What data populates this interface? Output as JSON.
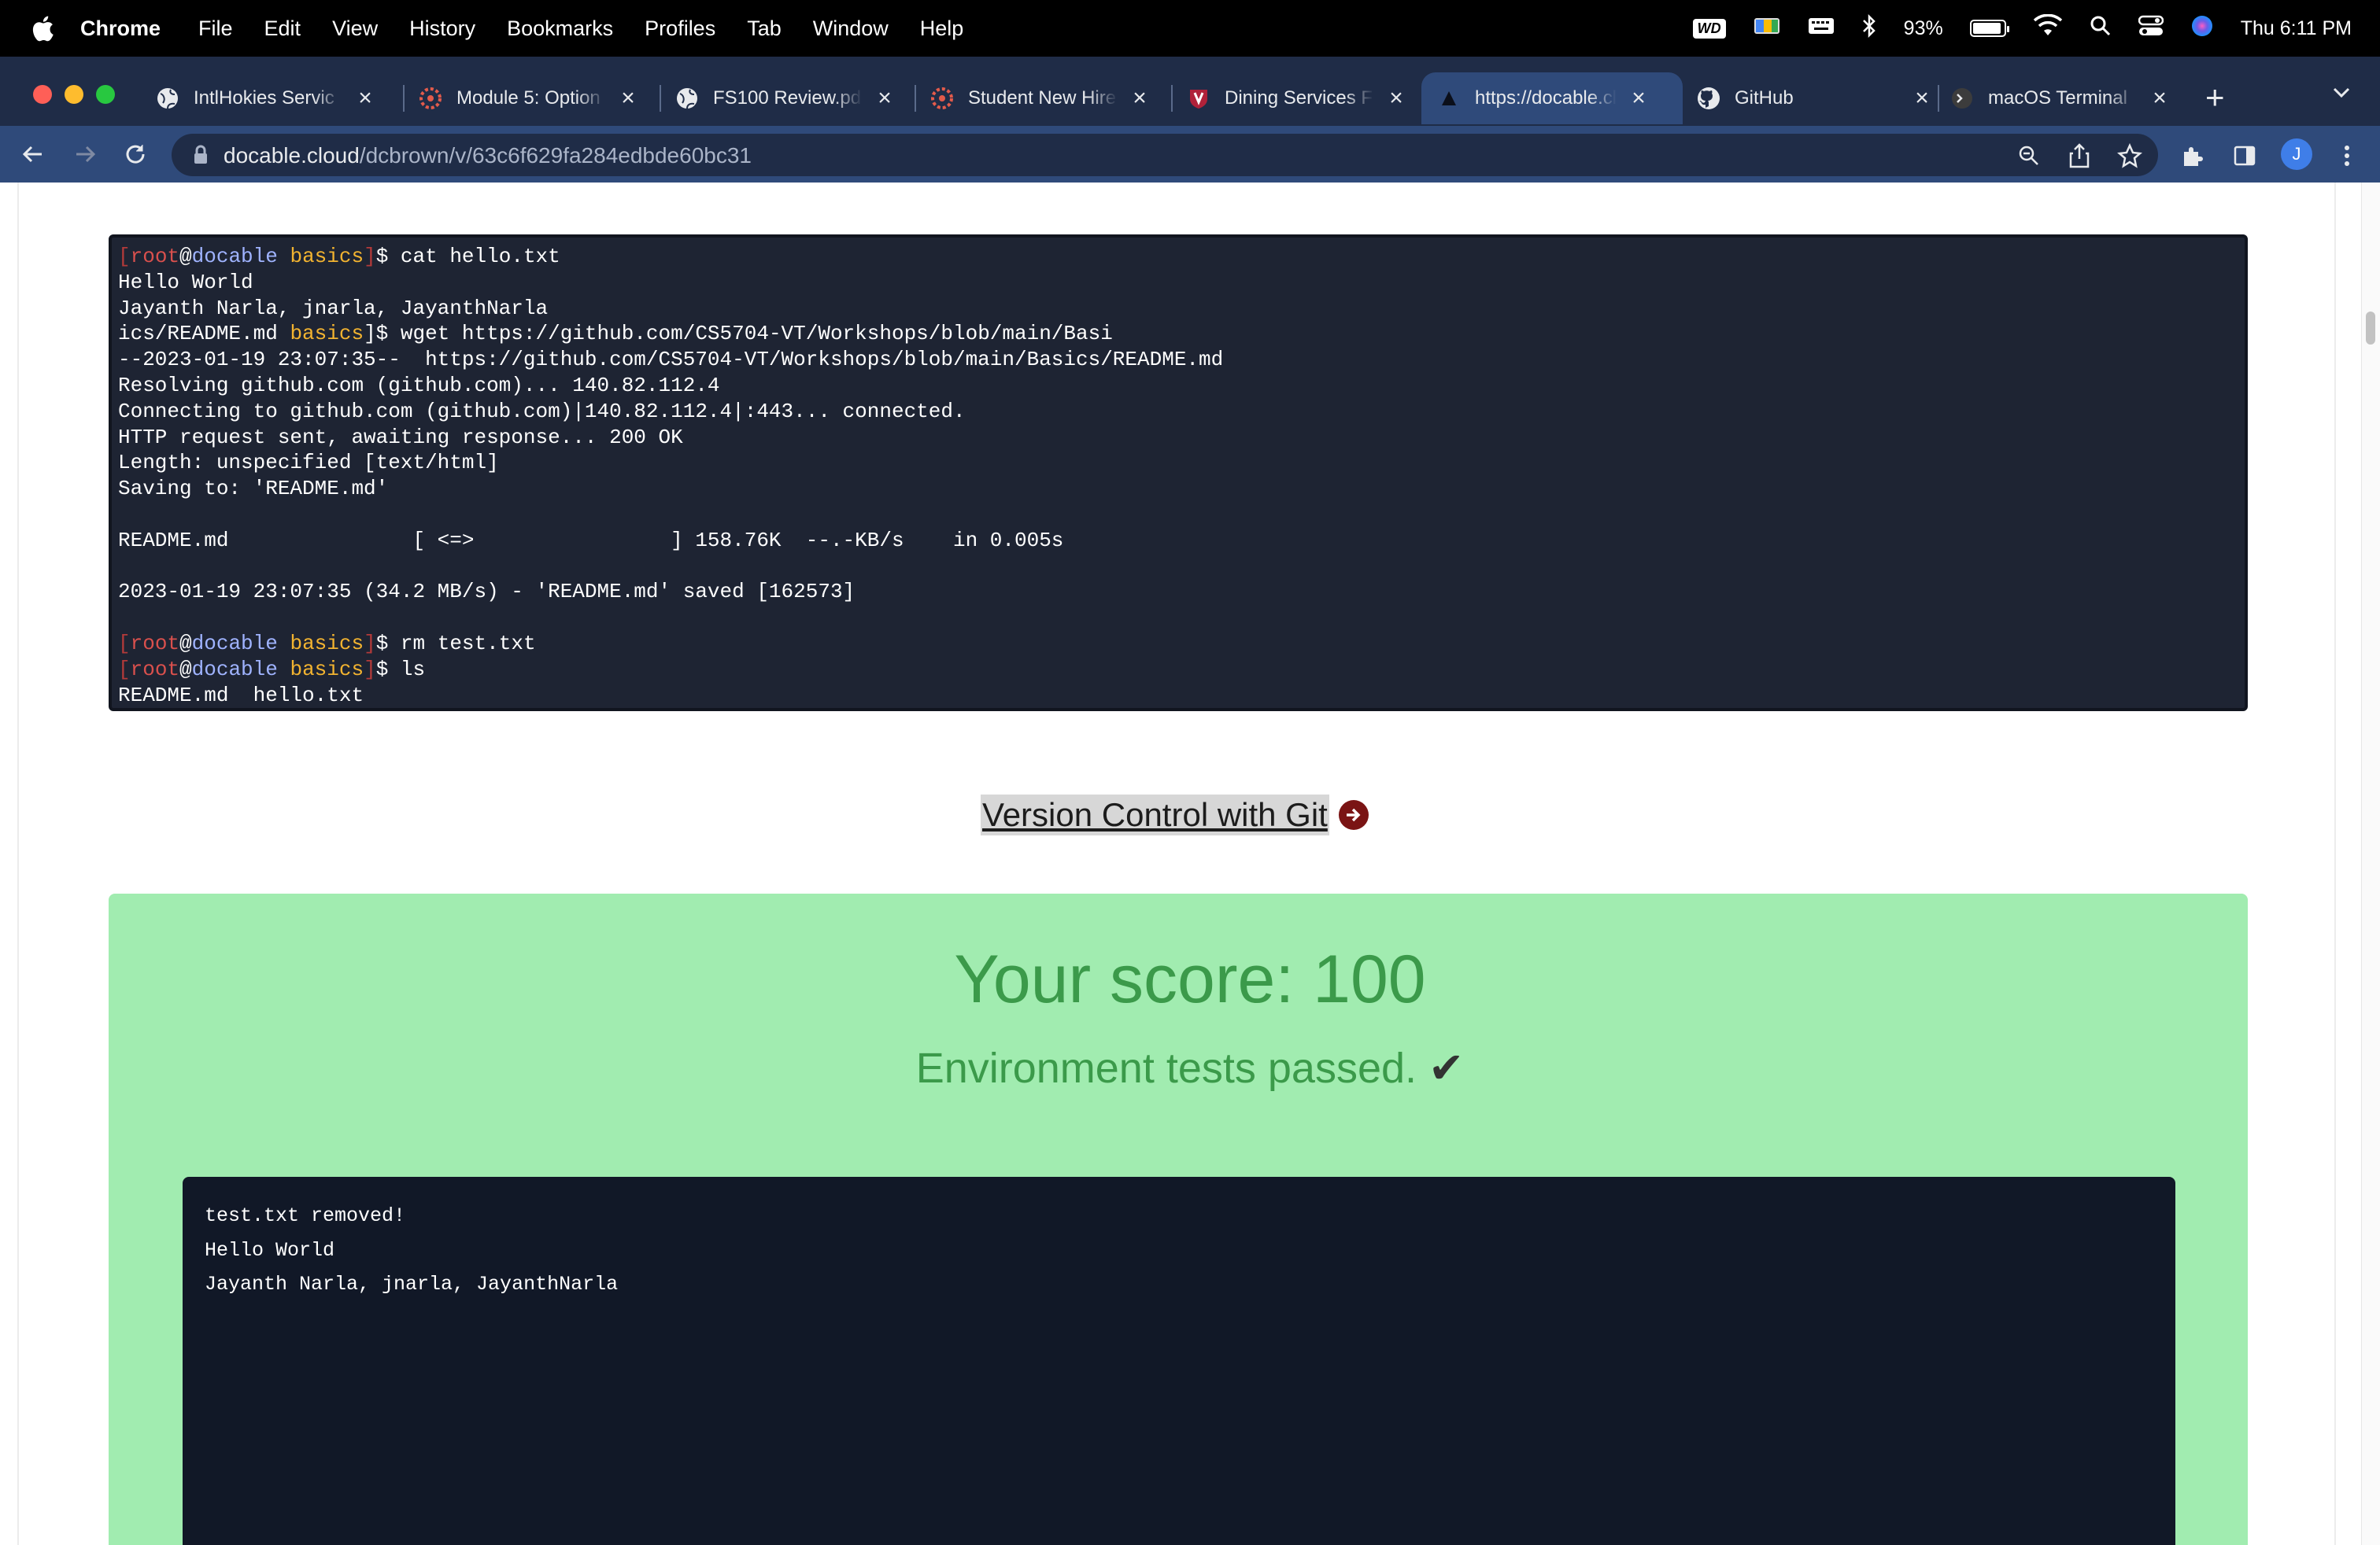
{
  "menubar": {
    "app_name": "Chrome",
    "items": [
      "File",
      "Edit",
      "View",
      "History",
      "Bookmarks",
      "Profiles",
      "Tab",
      "Window",
      "Help"
    ],
    "wd_badge": "WD",
    "battery_percent": "93%",
    "battery_level": 0.93,
    "clock": "Thu 6:11 PM"
  },
  "tabs": [
    {
      "title": "IntlHokies Servic",
      "favicon": "globe-icon"
    },
    {
      "title": "Module 5: Option",
      "favicon": "canvas-icon"
    },
    {
      "title": "FS100 Review.pd",
      "favicon": "globe-icon"
    },
    {
      "title": "Student New Hire",
      "favicon": "canvas-icon"
    },
    {
      "title": "Dining Services F",
      "favicon": "vt-icon"
    },
    {
      "title": "https://docable.cl",
      "favicon": "docable-icon",
      "active": true
    },
    {
      "title": "GitHub",
      "favicon": "github-icon"
    },
    {
      "title": "macOS Terminal",
      "favicon": "terminal-icon"
    }
  ],
  "omnibox": {
    "domain": "docable.cloud",
    "path": "/dcbrown/v/63c6f629fa284edbde60bc31"
  },
  "profile_initial": "J",
  "terminal": {
    "prompt_user": "root",
    "prompt_host": "docable",
    "prompt_dir": "basics",
    "line_01_cmd": "cat hello.txt",
    "line_02": "Hello World",
    "line_03": "Jayanth Narla, jnarla, JayanthNarla",
    "line_04_a": "ics/README.md ",
    "line_04_dir": "basics",
    "line_04_b": "]$ wget https://github.com/CS5704-VT/Workshops/blob/main/Basi",
    "line_05": "--2023-01-19 23:07:35--  https://github.com/CS5704-VT/Workshops/blob/main/Basics/README.md",
    "line_06": "Resolving github.com (github.com)... 140.82.112.4",
    "line_07": "Connecting to github.com (github.com)|140.82.112.4|:443... connected.",
    "line_08": "HTTP request sent, awaiting response... 200 OK",
    "line_09": "Length: unspecified [text/html]",
    "line_10": "Saving to: 'README.md'",
    "line_12": "README.md               [ <=>                ] 158.76K  --.-KB/s    in 0.005s",
    "line_14": "2023-01-19 23:07:35 (34.2 MB/s) - 'README.md' saved [162573]",
    "line_16_cmd": "rm test.txt",
    "line_17_cmd": "ls",
    "line_18": "README.md  hello.txt"
  },
  "next_link": "Version Control with Git",
  "score": {
    "title": "Your score: 100",
    "subtitle": "Environment tests passed.",
    "check": "✔"
  },
  "output": {
    "lines": [
      "test.txt removed!",
      "Hello World",
      "Jayanth Narla, jnarla, JayanthNarla"
    ]
  }
}
